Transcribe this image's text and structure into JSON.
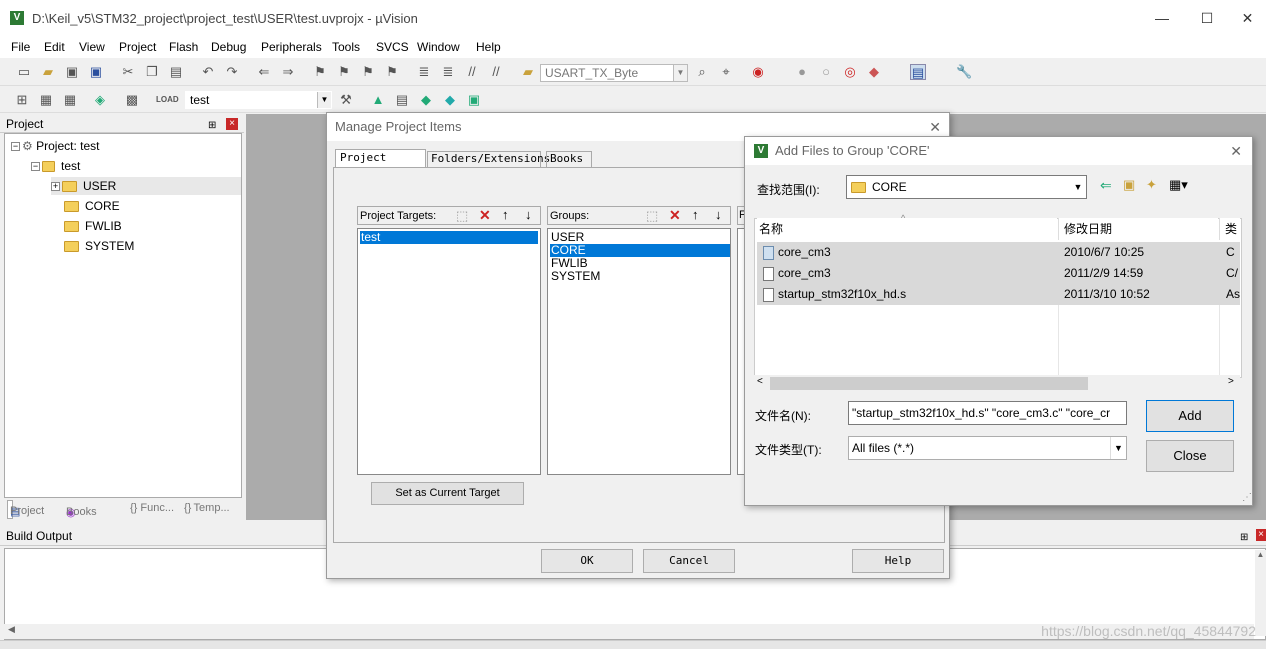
{
  "window": {
    "title": "D:\\Keil_v5\\STM32_project\\project_test\\USER\\test.uvprojx - µVision",
    "app_icon": "V",
    "minimize": "—",
    "maximize": "☐",
    "close": "✕"
  },
  "menu": [
    "File",
    "Edit",
    "View",
    "Project",
    "Flash",
    "Debug",
    "Peripherals",
    "Tools",
    "SVCS",
    "Window",
    "Help"
  ],
  "toolbar": {
    "find_combo": "USART_TX_Byte",
    "target_combo": "test"
  },
  "project_panel": {
    "header": "Project",
    "pin": "⊞",
    "close": "×",
    "tree": {
      "root": "Project: test",
      "target": "test",
      "groups": [
        "USER",
        "CORE",
        "FWLIB",
        "SYSTEM"
      ]
    },
    "tabs": [
      "Project",
      "Books",
      "{} Func...",
      "{} Temp..."
    ]
  },
  "build_output": {
    "header": "Build Output",
    "pin": "⊞",
    "close": "×"
  },
  "manage_dialog": {
    "title": "Manage Project Items",
    "close": "✕",
    "tabs": [
      "Project Items",
      "Folders/Extensions",
      "Books"
    ],
    "targets_label": "Project Targets:",
    "targets": [
      "test"
    ],
    "groups_label": "Groups:",
    "groups": [
      "USER",
      "CORE",
      "FWLIB",
      "SYSTEM"
    ],
    "files_label": "F",
    "set_current_target": "Set as Current Target",
    "ok": "OK",
    "cancel": "Cancel",
    "help": "Help"
  },
  "add_files_dialog": {
    "title": "Add Files to Group 'CORE'",
    "close": "✕",
    "look_in_label": "查找范围(I):",
    "look_in": "CORE",
    "columns": {
      "name": "名称",
      "date": "修改日期",
      "type": "类"
    },
    "files": [
      {
        "name": "core_cm3",
        "date": "2010/6/7 10:25",
        "type": "C :"
      },
      {
        "name": "core_cm3",
        "date": "2011/2/9 14:59",
        "type": "C/"
      },
      {
        "name": "startup_stm32f10x_hd.s",
        "date": "2011/3/10 10:52",
        "type": "As"
      }
    ],
    "filename_label": "文件名(N):",
    "filename": "\"startup_stm32f10x_hd.s\" \"core_cm3.c\" \"core_cr",
    "filetype_label": "文件类型(T):",
    "filetype": "All files (*.*)",
    "add": "Add",
    "close_btn": "Close"
  },
  "watermark": "https://blog.csdn.net/qq_45844792",
  "colors": {
    "selection": "#0078d7",
    "close_red": "#c82828",
    "folder": "#f4cf5b"
  }
}
